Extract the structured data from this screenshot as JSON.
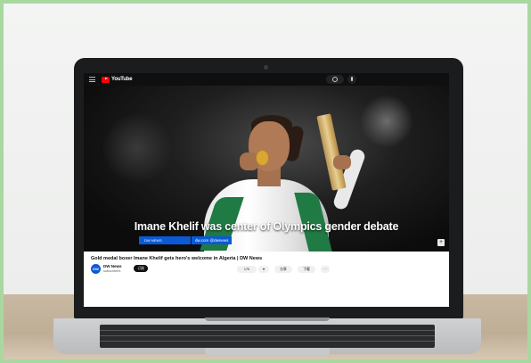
{
  "youtube": {
    "logo_text": "YouTube",
    "video": {
      "headline": "Imane Khelif was center of Olympics gender debate",
      "lower_third_brand": "DW NEWS",
      "lower_third_handle": "dw.com @dwnews",
      "fullscreen_icon": "+"
    },
    "title": "Gold medal boxer Imane Khelif gets hero's welcome in Algeria | DW News",
    "channel": {
      "avatar_text": "DW",
      "name": "DW News",
      "subscribers": "subscribers",
      "subscribe_label": "订阅"
    },
    "actions": {
      "like_count": "170",
      "dislike_icon": "thumbs-down-icon",
      "share_label": "分享",
      "download_label": "下载",
      "more_label": "···"
    }
  }
}
